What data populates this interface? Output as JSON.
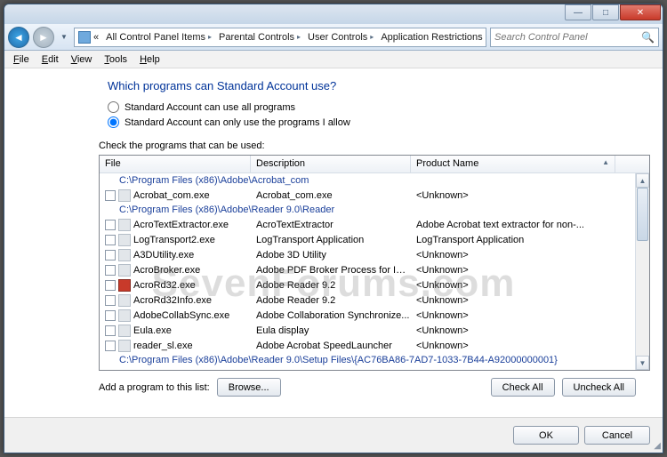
{
  "watermark": "SevenForums.com",
  "titlebar": {
    "min": "—",
    "max": "□",
    "close": "✕"
  },
  "nav": {
    "back": "◄",
    "fwd": "►",
    "drop": "▼",
    "refresh": "↻"
  },
  "address": {
    "prefix": "«",
    "crumbs": [
      "All Control Panel Items",
      "Parental Controls",
      "User Controls",
      "Application Restrictions"
    ]
  },
  "search": {
    "placeholder": "Search Control Panel"
  },
  "menu": [
    "File",
    "Edit",
    "View",
    "Tools",
    "Help"
  ],
  "heading": "Which programs can Standard Account use?",
  "radios": {
    "opt1": "Standard Account can use all programs",
    "opt2": "Standard Account can only use the programs I allow"
  },
  "list_label": "Check the programs that can be used:",
  "columns": {
    "c1": "File",
    "c2": "Description",
    "c3": "Product Name"
  },
  "groups": [
    "C:\\Program Files (x86)\\Adobe\\Acrobat_com",
    "C:\\Program Files (x86)\\Adobe\\Reader 9.0\\Reader",
    "C:\\Program Files (x86)\\Adobe\\Reader 9.0\\Setup Files\\{AC76BA86-7AD7-1033-7B44-A92000000001}"
  ],
  "rows": [
    {
      "file": "Acrobat_com.exe",
      "desc": "Acrobat_com.exe",
      "prod": "<Unknown>",
      "icon": ""
    },
    {
      "file": "AcroTextExtractor.exe",
      "desc": "AcroTextExtractor",
      "prod": "Adobe Acrobat text extractor for non-...",
      "icon": ""
    },
    {
      "file": "LogTransport2.exe",
      "desc": "LogTransport Application",
      "prod": "LogTransport Application",
      "icon": ""
    },
    {
      "file": "A3DUtility.exe",
      "desc": "Adobe 3D Utility",
      "prod": "<Unknown>",
      "icon": ""
    },
    {
      "file": "AcroBroker.exe",
      "desc": "Adobe PDF Broker Process for Int...",
      "prod": "<Unknown>",
      "icon": ""
    },
    {
      "file": "AcroRd32.exe",
      "desc": "Adobe Reader 9.2",
      "prod": "<Unknown>",
      "icon": "red"
    },
    {
      "file": "AcroRd32Info.exe",
      "desc": "Adobe Reader 9.2",
      "prod": "<Unknown>",
      "icon": ""
    },
    {
      "file": "AdobeCollabSync.exe",
      "desc": "Adobe Collaboration Synchronize...",
      "prod": "<Unknown>",
      "icon": ""
    },
    {
      "file": "Eula.exe",
      "desc": "Eula display",
      "prod": "<Unknown>",
      "icon": ""
    },
    {
      "file": "reader_sl.exe",
      "desc": "Adobe Acrobat SpeedLauncher",
      "prod": "<Unknown>",
      "icon": ""
    }
  ],
  "bottom": {
    "add_label": "Add a program to this list:",
    "browse": "Browse...",
    "checkall": "Check All",
    "uncheckall": "Uncheck All"
  },
  "footer": {
    "ok": "OK",
    "cancel": "Cancel"
  }
}
